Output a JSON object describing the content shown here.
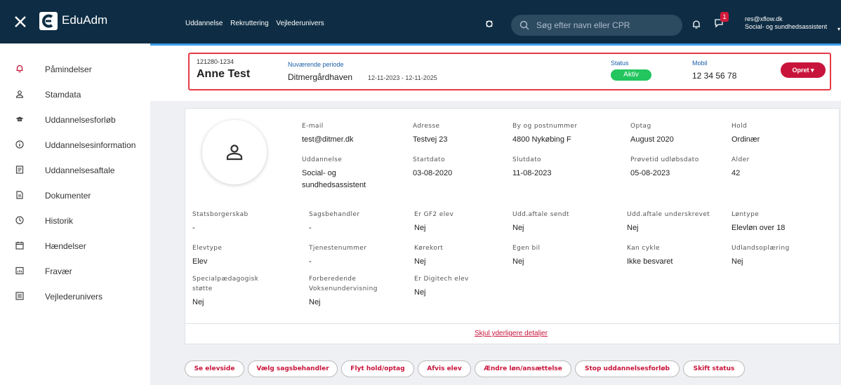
{
  "app": {
    "name": "EduAdm"
  },
  "topnav": [
    "Uddannelse",
    "Rekruttering",
    "Vejlederunivers"
  ],
  "search": {
    "placeholder": "Søg efter navn eller CPR"
  },
  "notifications": {
    "chat_count": "1"
  },
  "user": {
    "email": "res@xflow.dk",
    "role": "Social- og sundhedsassistent"
  },
  "sidebar": {
    "items": [
      {
        "label": "Påmindelser",
        "icon": "bell-icon"
      },
      {
        "label": "Stamdata",
        "icon": "person-icon"
      },
      {
        "label": "Uddannelsesforløb",
        "icon": "graduation-cap-icon"
      },
      {
        "label": "Uddannelsesinformation",
        "icon": "info-icon"
      },
      {
        "label": "Uddannelsesaftale",
        "icon": "contract-icon"
      },
      {
        "label": "Dokumenter",
        "icon": "document-icon"
      },
      {
        "label": "Historik",
        "icon": "clock-icon"
      },
      {
        "label": "Hændelser",
        "icon": "calendar-icon"
      },
      {
        "label": "Fravær",
        "icon": "chart-icon"
      },
      {
        "label": "Vejlederunivers",
        "icon": "list-icon"
      }
    ]
  },
  "student": {
    "cpr": "121280-1234",
    "name": "Anne Test",
    "period_label": "Nuværende periode",
    "place": "Ditmergårdhaven",
    "dates": "12-11-2023 - 12-11-2025",
    "status_label": "Status",
    "status": "Aktiv",
    "mobile_label": "Mobil",
    "mobile": "12 34 56 78",
    "create_label": "Opret ▾"
  },
  "details": {
    "fields": [
      {
        "label": "E-mail",
        "value": "test@ditmer.dk"
      },
      {
        "label": "Adresse",
        "value": "Testvej 23"
      },
      {
        "label": "By og postnummer",
        "value": "4800 Nykøbing F"
      },
      {
        "label": "Optag",
        "value": "August 2020"
      },
      {
        "label": "Hold",
        "value": "Ordinær"
      },
      {
        "label": "Uddannelse",
        "value": "Social- og\nsundhedsassistent"
      },
      {
        "label": "Startdato",
        "value": "03-08-2020"
      },
      {
        "label": "Slutdato",
        "value": "11-08-2023"
      },
      {
        "label": "Prøvetid udløbsdato",
        "value": "05-08-2023"
      },
      {
        "label": "Alder",
        "value": "42"
      },
      {
        "label": "Statsborgerskab",
        "value": "-"
      },
      {
        "label": "Sagsbehandler",
        "value": "-"
      },
      {
        "label": "Er GF2 elev",
        "value": "Nej"
      },
      {
        "label": "Udd.aftale sendt",
        "value": "Nej"
      },
      {
        "label": "Udd.aftale underskrevet",
        "value": "Nej"
      },
      {
        "label": "Løntype",
        "value": "Elevløn over 18"
      },
      {
        "label": "Elevtype",
        "value": "Elev"
      },
      {
        "label": "Tjenestenummer",
        "value": "-"
      },
      {
        "label": "Kørekort",
        "value": "Nej"
      },
      {
        "label": "Egen bil",
        "value": "Nej"
      },
      {
        "label": "Kan cykle",
        "value": "Ikke besvaret"
      },
      {
        "label": "Udlandsoplæring",
        "value": "Nej"
      },
      {
        "label": "Specialpædagogisk\nstøtte",
        "value": "Nej"
      },
      {
        "label": "Forberedende\nVoksenundervisning",
        "value": "Nej"
      },
      {
        "label": "Er Digitech elev",
        "value": "Nej"
      }
    ],
    "toggle_label": "Skjul yderligere detaljer"
  },
  "actions": [
    "Se elevside",
    "Vælg sagsbehandler",
    "Flyt hold/optag",
    "Afvis elev",
    "Ændre løn/ansættelse",
    "Stop uddannelsesforløb",
    "Skift status"
  ],
  "colors": {
    "topbar": "#0e2d44",
    "accent": "#c8143b",
    "status_active": "#22c55e",
    "highlight_border": "#e53a45"
  }
}
